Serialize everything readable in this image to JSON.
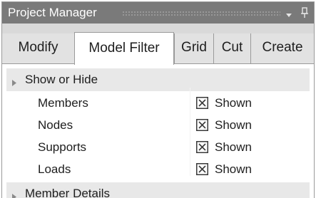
{
  "panel": {
    "title": "Project Manager"
  },
  "tabs": [
    {
      "label": "Modify",
      "active": false
    },
    {
      "label": "Model Filter",
      "active": true
    },
    {
      "label": "Grid",
      "active": false
    },
    {
      "label": "Cut",
      "active": false
    },
    {
      "label": "Create",
      "active": false
    }
  ],
  "sections": {
    "show_hide": {
      "label": "Show or Hide",
      "rows": [
        {
          "name": "Members",
          "checked": true,
          "value": "Shown"
        },
        {
          "name": "Nodes",
          "checked": true,
          "value": "Shown"
        },
        {
          "name": "Supports",
          "checked": true,
          "value": "Shown"
        },
        {
          "name": "Loads",
          "checked": true,
          "value": "Shown"
        }
      ]
    },
    "member_details": {
      "label": "Member Details"
    }
  },
  "icons": {
    "dropdown": "chevron-down-icon",
    "pin": "pin-icon",
    "expand": "expand-triangle-icon",
    "checkbox": "checked-box-icon"
  },
  "colors": {
    "titlebar": "#7a7a7a",
    "tabstrip": "#d9d9d9",
    "section_header": "#e8e8e8"
  }
}
